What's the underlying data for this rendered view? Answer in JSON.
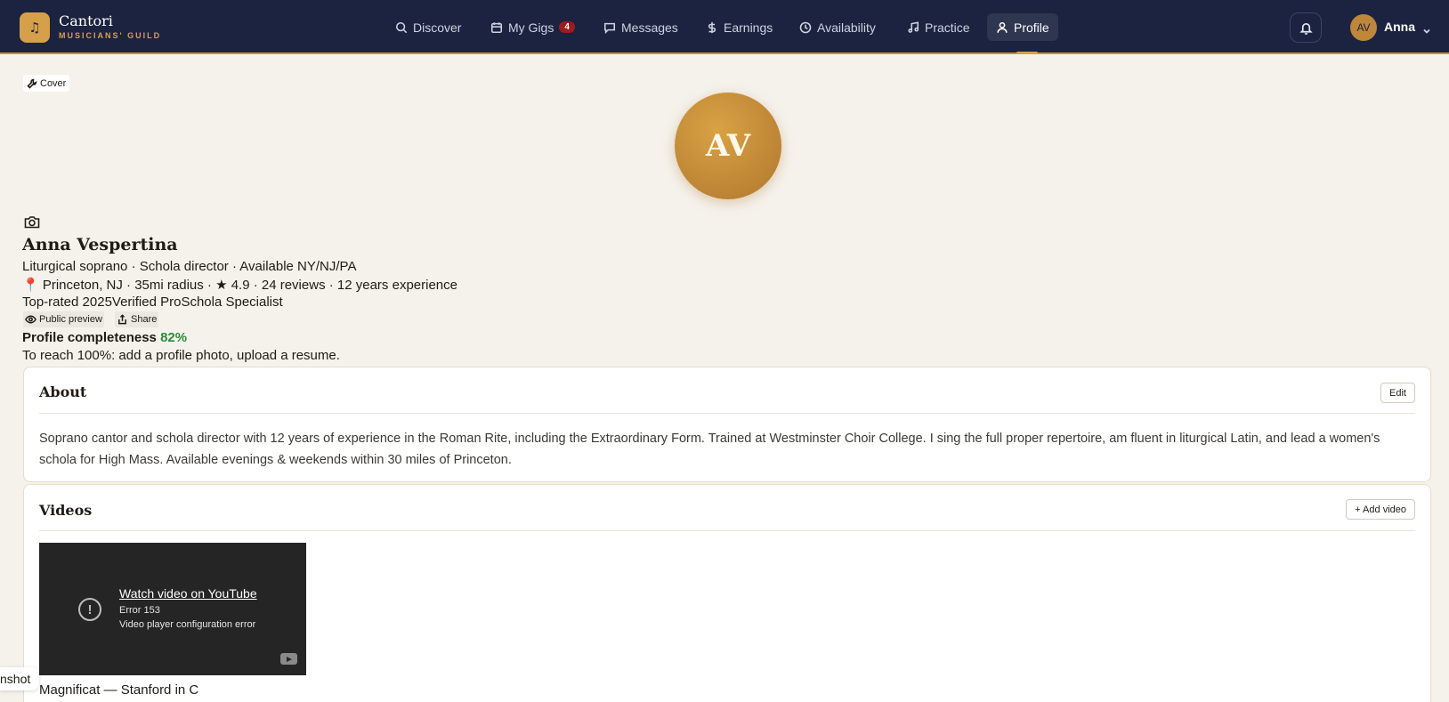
{
  "brand": {
    "name": "Cantori",
    "subtitle": "MUSICIANS' GUILD",
    "logo_icon": "music-note-icon"
  },
  "nav": {
    "discover": "Discover",
    "my_gigs": "My Gigs",
    "my_gigs_badge": "4",
    "messages": "Messages",
    "earnings": "Earnings",
    "availability": "Availability",
    "practice": "Practice",
    "profile": "Profile",
    "active": "Profile"
  },
  "user": {
    "initials": "AV",
    "name": "Anna"
  },
  "profile": {
    "cover_label": "Cover",
    "avatar_initials": "AV",
    "name": "Anna Vespertina",
    "tagline": "Liturgical soprano · Schola director · Available NY/NJ/PA",
    "location_line": "📍 Princeton, NJ · 35mi radius · ★ 4.9 · 24 reviews · 12 years experience",
    "badges": "Top-rated 2025Verified ProSchola Specialist",
    "public_preview_label": "Public preview",
    "share_label": "Share",
    "completeness_label": "Profile completeness",
    "completeness_value": "82%",
    "completeness_hint": "To reach 100%: add a profile photo, upload a resume."
  },
  "about": {
    "title": "About",
    "edit_label": "Edit",
    "text": "Soprano cantor and schola director with 12 years of experience in the Roman Rite, including the Extraordinary Form. Trained at Westminster Choir College. I sing the full proper repertoire, am fluent in liturgical Latin, and lead a women's schola for High Mass. Available evenings & weekends within 30 miles of Princeton."
  },
  "videos": {
    "title": "Videos",
    "add_label": "+ Add video",
    "items": [
      {
        "embed_link": "Watch video on YouTube",
        "error_code": "Error 153",
        "error_message": "Video player configuration error",
        "caption": "Magnificat — Stanford in C"
      }
    ]
  },
  "overlay": {
    "screenshot_tag": "nshot"
  },
  "colors": {
    "nav_bg": "#1b2340",
    "accent_gold": "#d6a04a",
    "page_bg": "#f5f2ec",
    "success_green": "#2e8b3a",
    "badge_red": "#9b1c1c"
  }
}
